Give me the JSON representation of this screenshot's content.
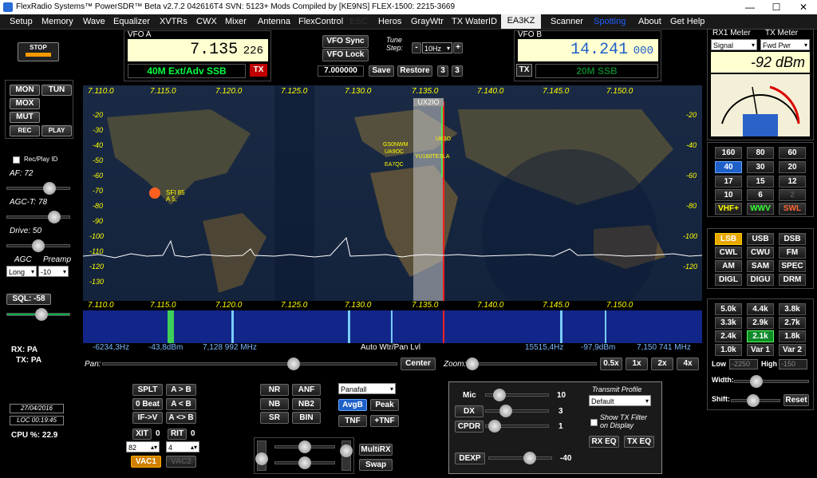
{
  "title": "FlexRadio Systems™  PowerSDR™  Beta  v2.7.2  042616T4   SVN: 5123+   Mods Compiled by [KE9NS]   FLEX-1500: 2215-3669",
  "window_controls": {
    "minimize": "—",
    "maximize": "☐",
    "close": "✕"
  },
  "menu": [
    "Setup",
    "Memory",
    "Wave",
    "Equalizer",
    "XVTRs",
    "CWX",
    "Mixer",
    "Antenna",
    "FlexControl",
    "ESC",
    "Heros",
    "GrayWtr",
    "TX WaterID",
    "EA3KZ",
    "Scanner",
    "Spotting",
    "About",
    "Get Help"
  ],
  "stop_label": "STOP",
  "vfo_a": {
    "label": "VFO A",
    "freq_main": "7.135",
    "freq_sub": "226",
    "band": "40M Ext/Adv SSB",
    "tx": "TX"
  },
  "vfo_b": {
    "label": "VFO B",
    "freq_main": "14.241",
    "freq_sub": "000",
    "band": "20M SSB",
    "tx": "TX"
  },
  "vfo_ctrl": {
    "sync": "VFO Sync",
    "lock": "VFO Lock",
    "tune_step_label": "Tune Step:",
    "tune_step": "10Hz",
    "minus": "-",
    "plus": "+",
    "mem_freq": "7.000000",
    "save": "Save",
    "restore": "Restore",
    "n1": "3",
    "n2": "3"
  },
  "meter": {
    "rx_label": "RX1 Meter",
    "tx_label": "TX Meter",
    "rx_sel": "Signal",
    "tx_sel": "Fwd Pwr",
    "reading": "-92 dBm"
  },
  "left": {
    "mon": "MON",
    "tun": "TUN",
    "mox": "MOX",
    "mut": "MUT",
    "rec": "REC",
    "play": "PLAY",
    "recplay": "Rec/Play ID",
    "af": "AF: 72",
    "agct": "AGC-T: 78",
    "drive": "Drive: 50",
    "agc": "AGC",
    "preamp": "Preamp",
    "agc_val": "Long",
    "preamp_val": "-10",
    "sql": "SQL: -58",
    "rx": "RX: PA",
    "tx": "TX: PA",
    "date": "27/04/2016",
    "loc": "LOC 00:19:45",
    "cpu": "CPU %: 22.9"
  },
  "pan": {
    "freq_ticks": [
      "7.110.0",
      "7.115.0",
      "7.120.0",
      "7.125.0",
      "7.130.0",
      "7.135.0",
      "7.140.0",
      "7.145.0",
      "7.150.0"
    ],
    "db_ticks": [
      "-20",
      "-30",
      "-40",
      "-50",
      "-60",
      "-70",
      "-80",
      "-90",
      "-100",
      "-110",
      "-120",
      "-130"
    ],
    "spot_overlay": "UX2IO",
    "spots": [
      "GS0NWM",
      "UA9OC",
      "EA7QC",
      "UK3O",
      "YU160TESLA"
    ],
    "sfi": "SFI 85",
    "sfi2": "A 5,",
    "wf_info": [
      "-6234,3Hz",
      "-43,8dBm",
      "7,128 992 MHz",
      "Auto Wtr/Pan Lvl",
      "15515,4Hz",
      "-97,9dBm",
      "7,150 741 MHz"
    ]
  },
  "pan_ctrl": {
    "pan": "Pan:",
    "center": "Center",
    "zoom": "Zoom:",
    "z05": "0.5x",
    "z1": "1x",
    "z2": "2x",
    "z4": "4x"
  },
  "bands": [
    "160",
    "80",
    "60",
    "40",
    "30",
    "20",
    "17",
    "15",
    "12",
    "10",
    "6",
    "2",
    "VHF+",
    "WWV",
    "SWL"
  ],
  "modes": [
    "LSB",
    "USB",
    "DSB",
    "CWL",
    "CWU",
    "FM",
    "AM",
    "SAM",
    "SPEC",
    "DIGL",
    "DIGU",
    "DRM"
  ],
  "filters": [
    "5.0k",
    "4.4k",
    "3.8k",
    "3.3k",
    "2.9k",
    "2.7k",
    "2.4k",
    "2.1k",
    "1.8k",
    "1.0k",
    "Var 1",
    "Var 2"
  ],
  "filter_ctrl": {
    "low": "Low",
    "low_val": "-2250",
    "high": "High",
    "high_val": "-150",
    "width": "Width:",
    "shift": "Shift:",
    "reset": "Reset"
  },
  "bottom": {
    "splt": "SPLT",
    "ab": "A > B",
    "zerobeat": "0 Beat",
    "ba": "A < B",
    "ifv": "IF->V",
    "aswap": "A <> B",
    "xit": "XIT",
    "xit_val": "0",
    "rit": "RIT",
    "rit_val": "0",
    "num1": "82",
    "num2": "4",
    "vac1": "VAC1",
    "vac2": "VAC2",
    "nr": "NR",
    "anf": "ANF",
    "nb": "NB",
    "nb2": "NB2",
    "sr": "SR",
    "bin": "BIN",
    "display_mode": "Panafall",
    "avgb": "AvgB",
    "peak": "Peak",
    "tnf": "TNF",
    "ptnf": "+TNF",
    "multirx": "MultiRX",
    "swap": "Swap"
  },
  "tx": {
    "mic": "Mic",
    "mic_val": "10",
    "dx": "DX",
    "dx_val": "3",
    "cpdr": "CPDR",
    "cpdr_val": "1",
    "dexp": "DEXP",
    "dexp_val": "-40",
    "profile_label": "Transmit Profile",
    "profile": "Default",
    "show_filter": "Show TX Filter on Display",
    "rxeq": "RX EQ",
    "txeq": "TX EQ"
  },
  "colors": {
    "accent_green": "#00ff40",
    "vfo_bg": "#ffffd0",
    "tx_red": "#c00000",
    "active_blue": "#1e5fc8",
    "pan_bg": "#0d1a33"
  }
}
